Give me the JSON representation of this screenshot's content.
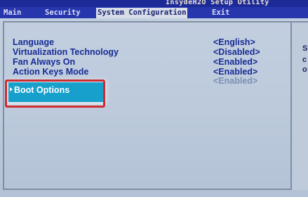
{
  "app_title": "InsydeH2O Setup Utility",
  "menu": [
    {
      "label": "Main",
      "selected": false
    },
    {
      "label": "Security",
      "selected": false
    },
    {
      "label": "System Configuration",
      "selected": true
    },
    {
      "label": "Exit",
      "selected": false
    }
  ],
  "settings": [
    {
      "label": "Language",
      "value": "<English>"
    },
    {
      "label": "Virtualization Technology",
      "value": "<Disabled>"
    },
    {
      "label": "Fan Always On",
      "value": "<Enabled>"
    },
    {
      "label": "Action Keys Mode",
      "value": "<Enabled>"
    },
    {
      "label": "",
      "value": "<Enabled>"
    },
    {
      "label": "Boot Options",
      "value": ""
    }
  ],
  "selected_setting": "Boot Options",
  "help_panel": {
    "chars": [
      "S",
      "c",
      "o"
    ]
  },
  "colors": {
    "menubar": "#2736ad",
    "titlebar": "#1c2a98",
    "text": "#172b95",
    "selection": "#18a0cc",
    "highlight_box": "#cc2d33",
    "background": "#c4d0e0"
  }
}
